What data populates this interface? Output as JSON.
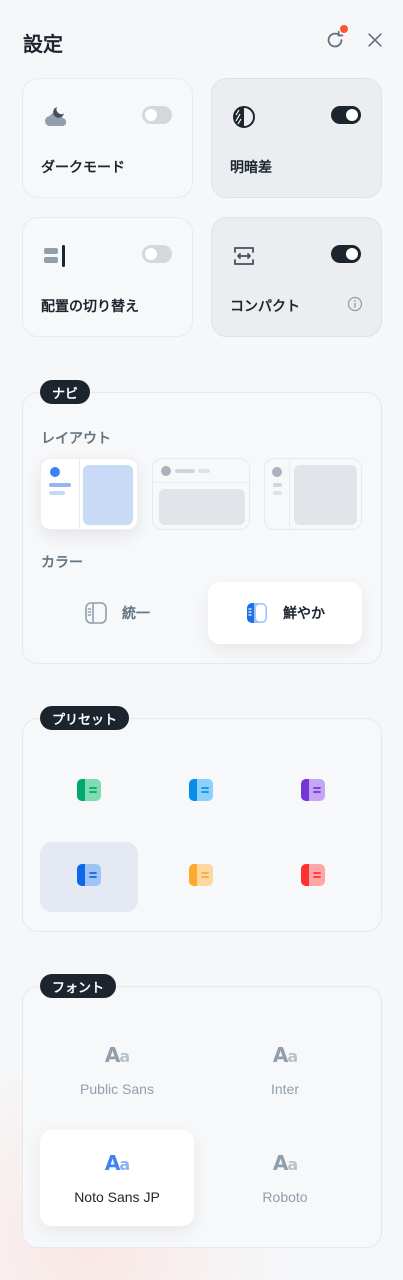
{
  "header": {
    "title": "設定",
    "reset_icon": "reset-icon",
    "close_icon": "close-icon"
  },
  "modes": [
    {
      "label": "ダークモード",
      "icon": "moon-cloud-icon",
      "enabled": false
    },
    {
      "label": "明暗差",
      "icon": "contrast-icon",
      "enabled": true
    },
    {
      "label": "配置の切り替え",
      "icon": "align-right-icon",
      "enabled": false
    },
    {
      "label": "コンパクト",
      "icon": "compact-icon",
      "enabled": true
    }
  ],
  "nav": {
    "title": "ナビ",
    "layout_label": "レイアウト",
    "layouts": [
      "vertical",
      "horizontal",
      "mini"
    ],
    "selected_layout": "vertical",
    "color_label": "カラー",
    "colors": [
      {
        "label": "統一",
        "icon": "sidebar-outline-icon"
      },
      {
        "label": "鮮やか",
        "icon": "sidebar-filled-icon"
      }
    ],
    "selected_color": "鮮やか"
  },
  "presets": {
    "title": "プリセット",
    "items": [
      {
        "name": "green",
        "color": "#00a76f",
        "light": "#7edcb0"
      },
      {
        "name": "cyan",
        "color": "#078dee",
        "light": "#8fd0fa"
      },
      {
        "name": "purple",
        "color": "#7635dc",
        "light": "#c4a6f2"
      },
      {
        "name": "blue",
        "color": "#0c68e9",
        "light": "#9fc3f6"
      },
      {
        "name": "orange",
        "color": "#fda92d",
        "light": "#fed8a0"
      },
      {
        "name": "red",
        "color": "#ff3030",
        "light": "#ffa6a6"
      }
    ],
    "selected": "blue"
  },
  "fonts": {
    "title": "フォント",
    "aa_big": "A",
    "aa_small": "a",
    "items": [
      "Public Sans",
      "Inter",
      "Noto Sans JP",
      "Roboto"
    ],
    "selected": "Noto Sans JP"
  }
}
